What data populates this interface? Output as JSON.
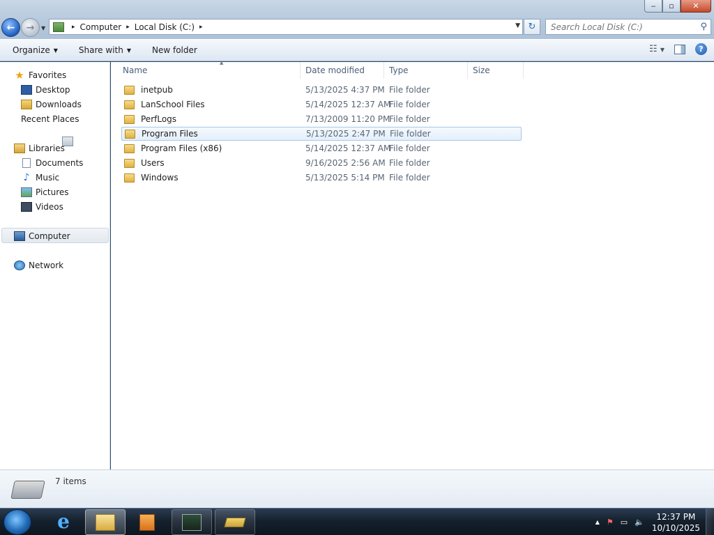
{
  "window": {
    "controls": {
      "minimize": "‒",
      "maximize": "▫",
      "close": "✕"
    }
  },
  "address": {
    "breadcrumbs": [
      "Computer",
      "Local Disk (C:)"
    ],
    "separator": "▸"
  },
  "search": {
    "placeholder": "Search Local Disk (C:)"
  },
  "toolbar": {
    "organize": "Organize",
    "share_with": "Share with",
    "new_folder": "New folder"
  },
  "nav": {
    "favorites": "Favorites",
    "desktop": "Desktop",
    "downloads": "Downloads",
    "recent_places": "Recent Places",
    "libraries": "Libraries",
    "documents": "Documents",
    "music": "Music",
    "pictures": "Pictures",
    "videos": "Videos",
    "computer": "Computer",
    "network": "Network"
  },
  "columns": {
    "name": "Name",
    "date_modified": "Date modified",
    "type": "Type",
    "size": "Size"
  },
  "files": [
    {
      "name": "inetpub",
      "date": "5/13/2025 4:37 PM",
      "type": "File folder"
    },
    {
      "name": "LanSchool Files",
      "date": "5/14/2025 12:37 AM",
      "type": "File folder"
    },
    {
      "name": "PerfLogs",
      "date": "7/13/2009 11:20 PM",
      "type": "File folder"
    },
    {
      "name": "Program Files",
      "date": "5/13/2025 2:47 PM",
      "type": "File folder"
    },
    {
      "name": "Program Files (x86)",
      "date": "5/14/2025 12:37 AM",
      "type": "File folder"
    },
    {
      "name": "Users",
      "date": "9/16/2025 2:56 AM",
      "type": "File folder"
    },
    {
      "name": "Windows",
      "date": "5/13/2025 5:14 PM",
      "type": "File folder"
    }
  ],
  "status": {
    "count": "7 items"
  },
  "clock": {
    "time": "12:37 PM",
    "date": "10/10/2025"
  },
  "icons": {
    "back": "←",
    "forward": "→",
    "refresh": "↻",
    "search": "⚲",
    "star": "★",
    "music": "♪",
    "help": "?",
    "ie": "e",
    "tray_up": "▲"
  }
}
